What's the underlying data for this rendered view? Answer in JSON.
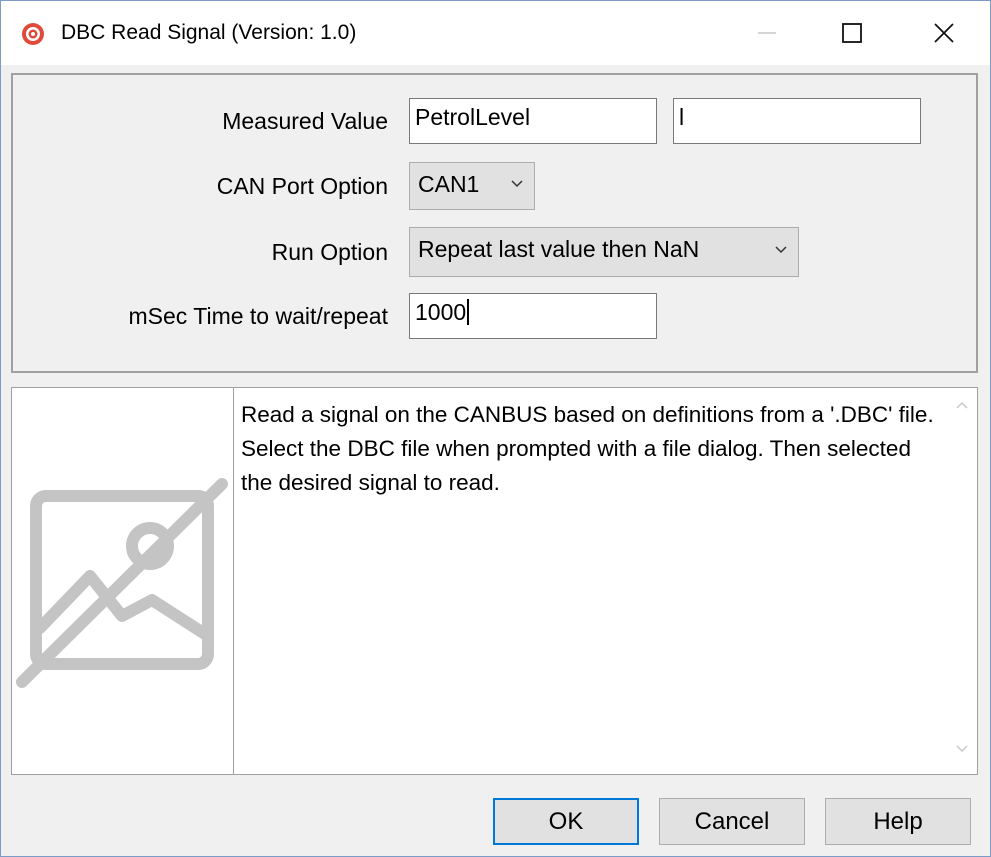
{
  "window": {
    "title": "DBC Read Signal (Version: 1.0)",
    "icons": {
      "app": "app-target-icon",
      "minimize": "minimize-icon",
      "maximize": "maximize-icon",
      "close": "close-icon"
    },
    "accent": "#0078d7"
  },
  "params": {
    "measured_value": {
      "label": "Measured Value",
      "name": "PetrolLevel",
      "unit": "l"
    },
    "can_port": {
      "label": "CAN Port Option",
      "selected": "CAN1"
    },
    "run_option": {
      "label": "Run Option",
      "selected": "Repeat last value then NaN"
    },
    "wait_time": {
      "label": "mSec Time to wait/repeat",
      "value": "1000"
    }
  },
  "description": {
    "image_icon": "image-placeholder-icon",
    "text": "Read a signal on the CANBUS based on definitions from a '.DBC' file.  Select the DBC file when prompted with a file dialog.  Then selected the desired signal to read."
  },
  "buttons": {
    "ok": "OK",
    "cancel": "Cancel",
    "help": "Help"
  }
}
